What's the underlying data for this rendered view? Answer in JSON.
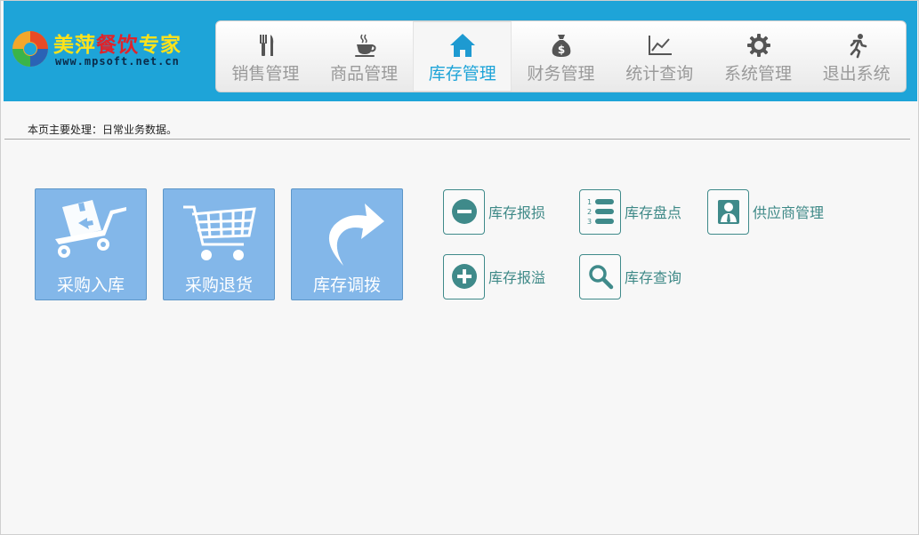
{
  "logo": {
    "title_part1": "美萍",
    "title_part2": "餐饮",
    "title_part3": "专家",
    "url": "www.mpsoft.net.cn"
  },
  "nav": {
    "items": [
      {
        "label": "销售管理",
        "icon": "utensils-icon"
      },
      {
        "label": "商品管理",
        "icon": "coffee-cup-icon"
      },
      {
        "label": "库存管理",
        "icon": "home-icon",
        "active": true
      },
      {
        "label": "财务管理",
        "icon": "money-bag-icon"
      },
      {
        "label": "统计查询",
        "icon": "line-chart-icon"
      },
      {
        "label": "系统管理",
        "icon": "gear-icon"
      },
      {
        "label": "退出系统",
        "icon": "running-man-icon"
      }
    ]
  },
  "page": {
    "description": "本页主要处理：日常业务数据。"
  },
  "big_tiles": [
    {
      "label": "采购入库",
      "icon": "hand-truck-icon"
    },
    {
      "label": "采购退货",
      "icon": "shopping-cart-icon"
    },
    {
      "label": "库存调拨",
      "icon": "curved-arrow-icon"
    }
  ],
  "small_buttons": [
    {
      "label": "库存报损",
      "icon": "minus-circle-icon"
    },
    {
      "label": "库存盘点",
      "icon": "numbered-list-icon"
    },
    {
      "label": "供应商管理",
      "icon": "supplier-person-icon"
    },
    {
      "label": "库存报溢",
      "icon": "plus-circle-icon"
    },
    {
      "label": "库存查询",
      "icon": "search-icon"
    }
  ],
  "colors": {
    "header": "#1ea4d8",
    "active_nav": "#1ea4d8",
    "tile": "#83b7e9",
    "small_button_text": "#3e8987"
  }
}
